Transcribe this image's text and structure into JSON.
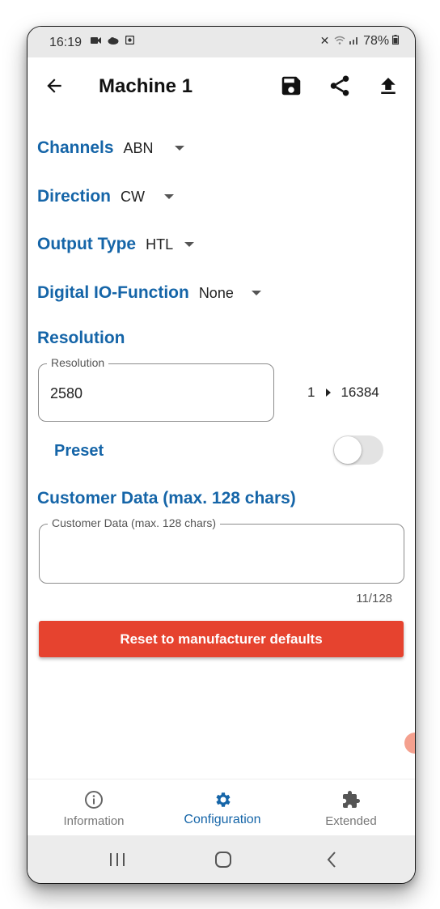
{
  "status_bar": {
    "time": "16:19",
    "battery": "78%"
  },
  "app_bar": {
    "title": "Machine 1"
  },
  "settings": {
    "channels": {
      "label": "Channels",
      "value": "ABN"
    },
    "direction": {
      "label": "Direction",
      "value": "CW"
    },
    "output_type": {
      "label": "Output Type",
      "value": "HTL"
    },
    "digital_io": {
      "label": "Digital IO-Function",
      "value": "None"
    }
  },
  "resolution": {
    "heading": "Resolution",
    "field_label": "Resolution",
    "value": "2580",
    "range_min": "1",
    "range_max": "16384"
  },
  "preset": {
    "label": "Preset",
    "enabled": false
  },
  "customer_data": {
    "heading": "Customer Data (max. 128 chars)",
    "field_label": "Customer Data (max. 128 chars)",
    "value": "",
    "counter": "11/128"
  },
  "reset_button": {
    "label": "Reset to manufacturer defaults"
  },
  "bottom_nav": {
    "items": [
      {
        "label": "Information",
        "active": false
      },
      {
        "label": "Configuration",
        "active": true
      },
      {
        "label": "Extended",
        "active": false
      }
    ]
  },
  "colors": {
    "accent": "#1565a8",
    "reset": "#e6432f"
  }
}
